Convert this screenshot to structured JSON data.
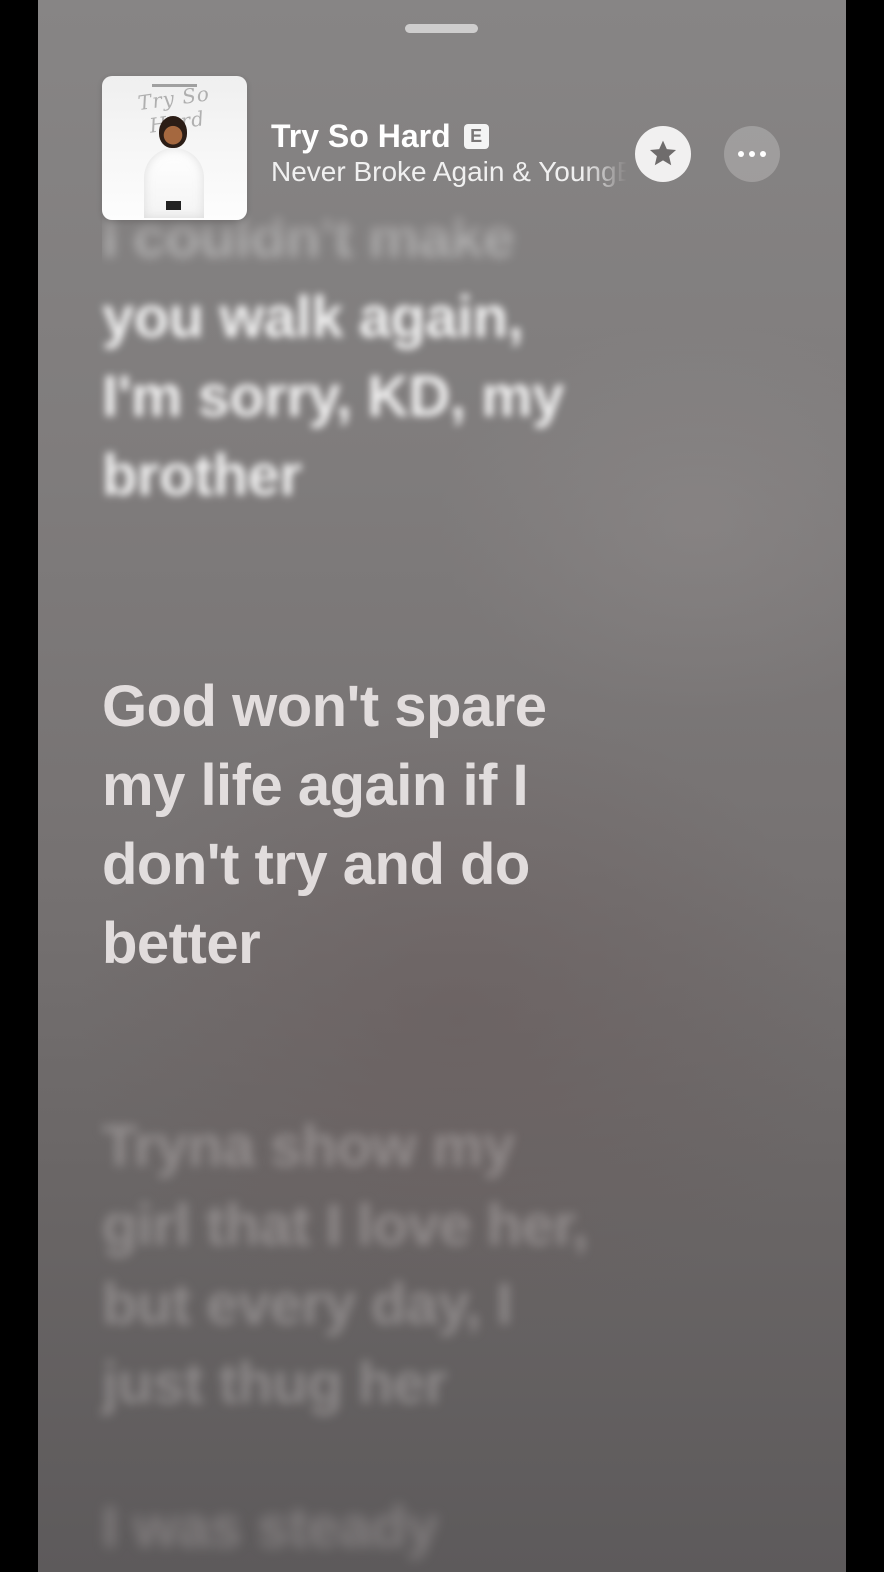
{
  "header": {
    "song_title": "Try So Hard",
    "explicit_badge": "E",
    "artist": "Never Broke Again & YoungBoy Never Broke Again",
    "artwork_title": "Try So Hard",
    "favorite_icon": "star-icon",
    "more_icon": "ellipsis-icon"
  },
  "lyrics": {
    "faded_top": [
      "I couldn't make"
    ],
    "past": [
      "you walk again,",
      "I'm sorry, KD, my",
      "brother"
    ],
    "active": [
      "God won't spare",
      "my life again if I",
      "don't try and do",
      "better"
    ],
    "next": [
      "Tryna show my",
      "girl that I love her,",
      "but every day, I",
      "just thug her"
    ],
    "next2": [
      "I was steady"
    ]
  },
  "colors": {
    "background": "#7f7c7c",
    "active_lyric": "#f0ecec",
    "title_text": "#ffffff"
  }
}
